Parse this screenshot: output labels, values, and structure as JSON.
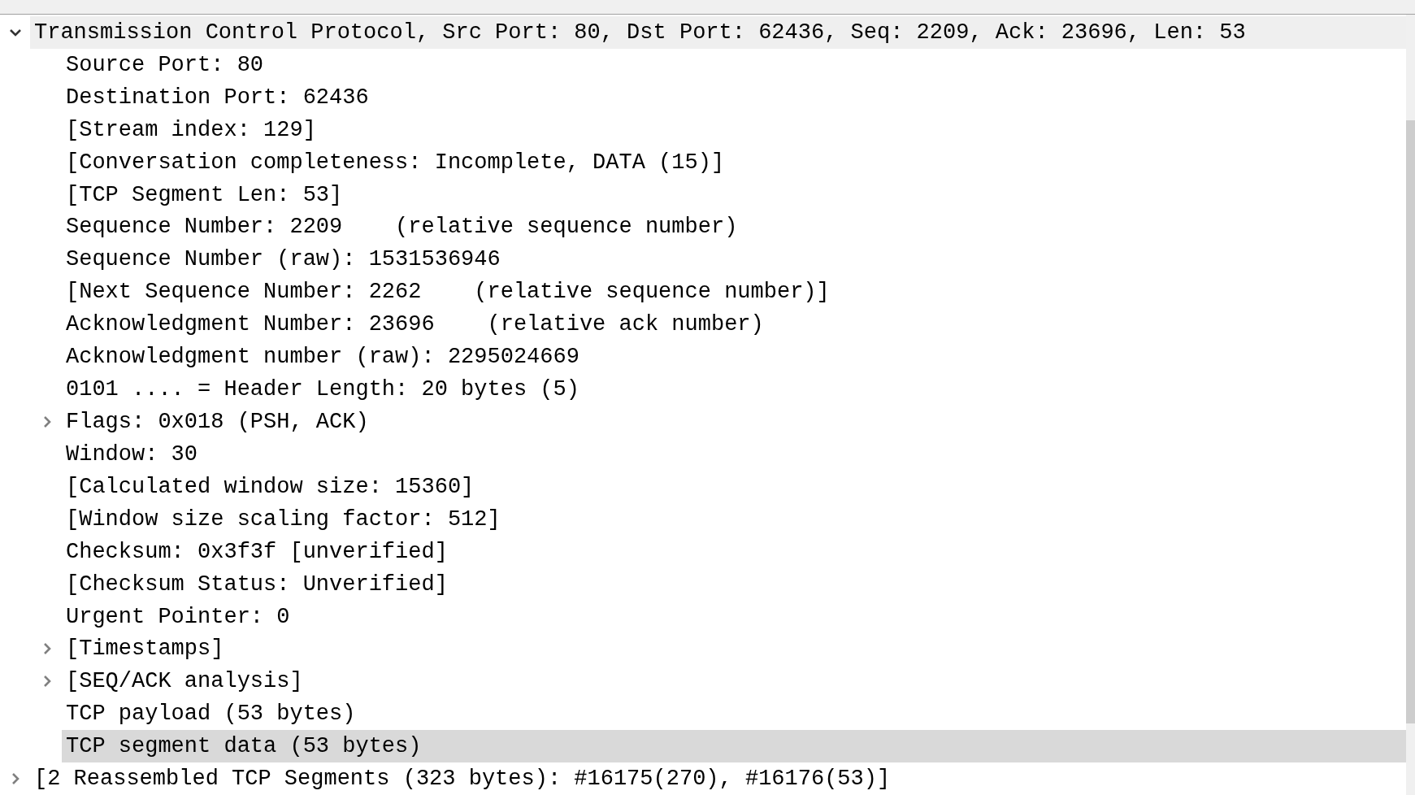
{
  "tree": [
    {
      "label": "Transmission Control Protocol, Src Port: 80, Dst Port: 62436, Seq: 2209, Ack: 23696, Len: 53",
      "expanded": true,
      "highlighted": true,
      "selected": false,
      "children": [
        {
          "label": "Source Port: 80",
          "selected": false
        },
        {
          "label": "Destination Port: 62436",
          "selected": false
        },
        {
          "label": "[Stream index: 129]",
          "selected": false
        },
        {
          "label": "[Conversation completeness: Incomplete, DATA (15)]",
          "selected": false
        },
        {
          "label": "[TCP Segment Len: 53]",
          "selected": false
        },
        {
          "label": "Sequence Number: 2209    (relative sequence number)",
          "selected": false
        },
        {
          "label": "Sequence Number (raw): 1531536946",
          "selected": false
        },
        {
          "label": "[Next Sequence Number: 2262    (relative sequence number)]",
          "selected": false
        },
        {
          "label": "Acknowledgment Number: 23696    (relative ack number)",
          "selected": false
        },
        {
          "label": "Acknowledgment number (raw): 2295024669",
          "selected": false
        },
        {
          "label": "0101 .... = Header Length: 20 bytes (5)",
          "selected": false
        },
        {
          "label": "Flags: 0x018 (PSH, ACK)",
          "expanded": false,
          "selected": false
        },
        {
          "label": "Window: 30",
          "selected": false
        },
        {
          "label": "[Calculated window size: 15360]",
          "selected": false
        },
        {
          "label": "[Window size scaling factor: 512]",
          "selected": false
        },
        {
          "label": "Checksum: 0x3f3f [unverified]",
          "selected": false
        },
        {
          "label": "[Checksum Status: Unverified]",
          "selected": false
        },
        {
          "label": "Urgent Pointer: 0",
          "selected": false
        },
        {
          "label": "[Timestamps]",
          "expanded": false,
          "selected": false
        },
        {
          "label": "[SEQ/ACK analysis]",
          "expanded": false,
          "selected": false
        },
        {
          "label": "TCP payload (53 bytes)",
          "selected": false
        },
        {
          "label": "TCP segment data (53 bytes)",
          "selected": true
        }
      ]
    },
    {
      "label": "[2 Reassembled TCP Segments (323 bytes): #16175(270), #16176(53)]",
      "expanded": false,
      "highlighted": false,
      "selected": false
    }
  ]
}
